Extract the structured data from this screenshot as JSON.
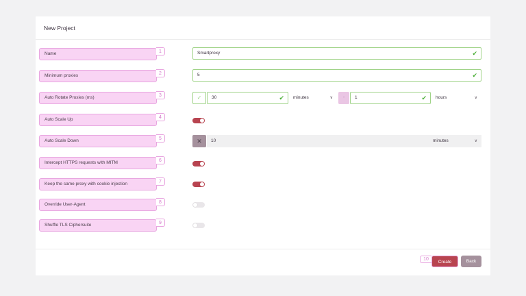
{
  "form": {
    "title": "New Project",
    "fields": [
      {
        "label": "Name",
        "index": "1"
      },
      {
        "label": "Minimum proxies",
        "index": "2"
      },
      {
        "label": "Auto Rotate Proxies (ms)",
        "index": "3"
      },
      {
        "label": "Auto Scale Up",
        "index": "4"
      },
      {
        "label": "Auto Scale Down",
        "index": "5"
      },
      {
        "label": "Intercept HTTPS requests with MITM",
        "index": "6"
      },
      {
        "label": "Keep the same proxy with cookie injection",
        "index": "7"
      },
      {
        "label": "Override User-Agent",
        "index": "8"
      },
      {
        "label": "Shuffle TLS Ciphersuite",
        "index": "9"
      }
    ],
    "name_value": "Smartproxy",
    "min_proxies_value": "5",
    "rotate": {
      "min_value": "30",
      "min_unit": "minutes",
      "separator": "-",
      "max_value": "1",
      "max_unit": "hours"
    },
    "scale_down": {
      "value": "10",
      "unit": "minutes"
    },
    "toggles": {
      "auto_scale_up": true,
      "intercept_https": true,
      "keep_same_proxy": true,
      "override_user_agent": false,
      "shuffle_tls": false
    }
  },
  "footer": {
    "create_index": "10",
    "create_label": "Create",
    "back_label": "Back"
  },
  "colors": {
    "accent": "#b84450",
    "label_bg": "#f9d4f4",
    "valid_border": "#9fd387",
    "back_button": "#a5919d"
  }
}
